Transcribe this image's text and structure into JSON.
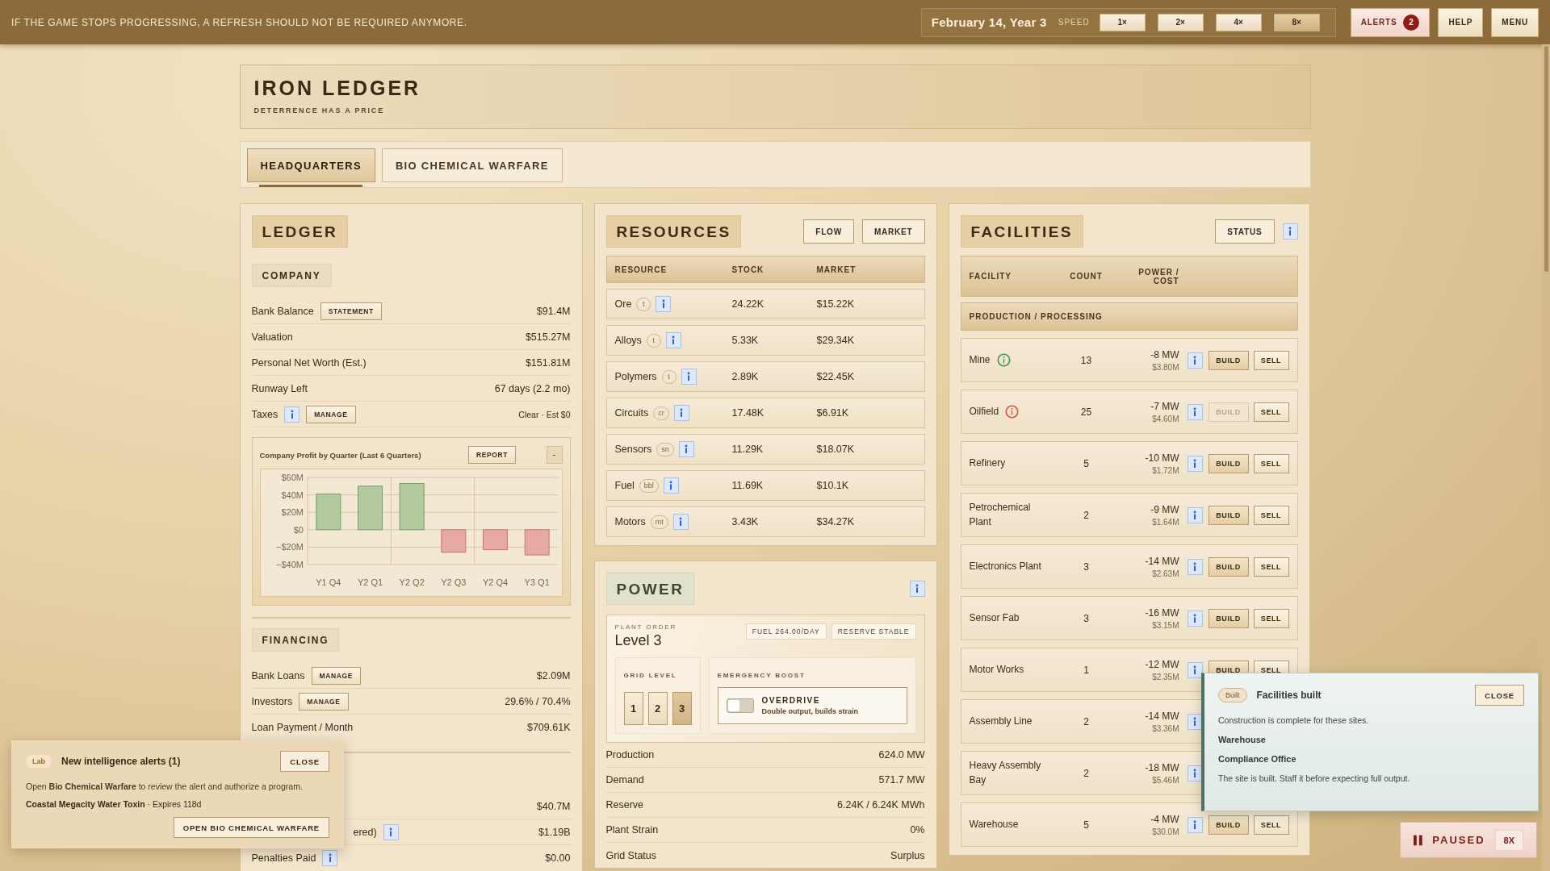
{
  "top_bar": {
    "notice": "IF THE GAME STOPS PROGRESSING, A REFRESH SHOULD NOT BE REQUIRED ANYMORE.",
    "date": "February 14, Year 3",
    "speed_label": "SPEED",
    "speeds": [
      {
        "label": "1×",
        "selected": false
      },
      {
        "label": "2×",
        "selected": false
      },
      {
        "label": "4×",
        "selected": false
      },
      {
        "label": "8×",
        "selected": true
      }
    ],
    "alerts": {
      "label": "ALERTS",
      "count": "2"
    },
    "buttons": [
      "HELP",
      "MENU"
    ]
  },
  "header": {
    "title": "IRON LEDGER",
    "subtitle": "DETERRENCE HAS A PRICE"
  },
  "tabs": [
    {
      "label": "HEADQUARTERS",
      "selected": true
    },
    {
      "label": "BIO CHEMICAL WARFARE",
      "selected": false
    }
  ],
  "ledger": {
    "title": "LEDGER",
    "sections": [
      {
        "title": "COMPANY",
        "rows": [
          {
            "kind": "plain",
            "label": "Bank Balance",
            "info": false,
            "button": "STATEMENT",
            "value": "$91.4M"
          },
          {
            "kind": "plain",
            "label": "Valuation",
            "info": false,
            "value": "$515.27M"
          },
          {
            "kind": "plain",
            "label": "Personal Net Worth (Est.)",
            "info": false,
            "value": "$151.81M"
          },
          {
            "kind": "plain",
            "label": "Runway Left",
            "info": false,
            "value": "67 days (2.2 mo)"
          },
          {
            "kind": "small",
            "label": "Taxes",
            "info": true,
            "button": "MANAGE",
            "value": "Clear · Est $0"
          }
        ],
        "chart": {
          "buttons": [
            "REPORT",
            "-"
          ],
          "chart_data": {
            "type": "bar",
            "grid": true,
            "title": "Company Profit by Quarter (Last 6 Quarters)",
            "categories": [
              "Y1 Q4",
              "Y2 Q1",
              "Y2 Q2",
              "Y2 Q3",
              "Y2 Q4",
              "Y3 Q1"
            ],
            "values": [
              41,
              50,
              53,
              -26,
              -23,
              -29
            ],
            "ylim": [
              -40,
              60
            ],
            "yticks": [
              {
                "value": 60,
                "label": "$60M"
              },
              {
                "value": 40,
                "label": "$40M"
              },
              {
                "value": 20,
                "label": "$20M"
              },
              {
                "value": 0,
                "label": "$0"
              },
              {
                "value": -20,
                "label": "−$20M"
              },
              {
                "value": -40,
                "label": "−$40M"
              }
            ]
          }
        }
      },
      {
        "title": "FINANCING",
        "rows": [
          {
            "kind": "plain",
            "label": "Bank Loans",
            "info": false,
            "button": "MANAGE",
            "value": "$2.09M"
          },
          {
            "kind": "plain",
            "label": "Investors",
            "info": false,
            "button": "MANAGE",
            "value": "29.6% / 70.4%"
          },
          {
            "kind": "plain",
            "label": "Loan Payment / Month",
            "info": false,
            "value": "$709.61K"
          }
        ]
      },
      {
        "rows": [
          {
            "kind": "covered",
            "info": false,
            "value": "$40.7M"
          },
          {
            "kind": "covered",
            "label": "ered)",
            "info": true,
            "value": "$1.19B"
          },
          {
            "kind": "plain",
            "label": "Penalties Paid",
            "info": true,
            "value": "$0.00"
          }
        ]
      }
    ]
  },
  "resources": {
    "title": "RESOURCES",
    "buttons": [
      "FLOW",
      "MARKET"
    ],
    "columns": [
      "RESOURCE",
      "STOCK",
      "MARKET"
    ],
    "rows": [
      {
        "name": "Ore",
        "unit": "t",
        "stock": "24.22K",
        "market": "$15.22K"
      },
      {
        "name": "Alloys",
        "unit": "t",
        "stock": "5.33K",
        "market": "$29.34K"
      },
      {
        "name": "Polymers",
        "unit": "t",
        "stock": "2.89K",
        "market": "$22.45K"
      },
      {
        "name": "Circuits",
        "unit": "cr",
        "stock": "17.48K",
        "market": "$6.91K"
      },
      {
        "name": "Sensors",
        "unit": "sn",
        "stock": "11.29K",
        "market": "$18.07K"
      },
      {
        "name": "Fuel",
        "unit": "bbl",
        "stock": "11.69K",
        "market": "$10.1K"
      },
      {
        "name": "Motors",
        "unit": "mt",
        "stock": "3.43K",
        "market": "$34.27K"
      }
    ]
  },
  "power": {
    "title": "POWER",
    "plant_order_label": "PLANT ORDER",
    "plant_order": "Level 3",
    "chips": [
      "FUEL 264.00/DAY",
      "RESERVE STABLE"
    ],
    "grid_level": {
      "label": "GRID LEVEL",
      "options": [
        {
          "label": "1",
          "selected": false
        },
        {
          "label": "2",
          "selected": false
        },
        {
          "label": "3",
          "selected": true
        }
      ]
    },
    "boost": {
      "label": "EMERGENCY BOOST",
      "name": "OVERDRIVE",
      "description": "Double output, builds strain",
      "on": false
    },
    "stats": [
      {
        "label": "Production",
        "value": "624.0 MW"
      },
      {
        "label": "Demand",
        "value": "571.7 MW"
      },
      {
        "label": "Reserve",
        "value": "6.24K / 6.24K MWh"
      },
      {
        "label": "Plant Strain",
        "value": "0%"
      },
      {
        "label": "Grid Status",
        "value": "Surplus"
      }
    ]
  },
  "facilities": {
    "title": "FACILITIES",
    "button": "STATUS",
    "columns": [
      "FACILITY",
      "COUNT",
      "POWER / COST"
    ],
    "group": "PRODUCTION / PROCESSING",
    "rows": [
      {
        "name": "Mine",
        "color": "#3f9a4f",
        "count": "13",
        "power": "-8 MW",
        "cost": "$3.80M",
        "actions": [
          {
            "label": "BUILD",
            "disabled": false
          },
          {
            "label": "SELL",
            "disabled": false
          }
        ]
      },
      {
        "name": "Oilfield",
        "color": "#d2554c",
        "count": "25",
        "power": "-7 MW",
        "cost": "$4.60M",
        "actions": [
          {
            "label": "BUILD",
            "disabled": true
          },
          {
            "label": "SELL",
            "disabled": false
          }
        ]
      },
      {
        "name": "Refinery",
        "count": "5",
        "power": "-10 MW",
        "cost": "$1.72M",
        "actions": [
          {
            "label": "BUILD",
            "disabled": false
          },
          {
            "label": "SELL",
            "disabled": false
          }
        ]
      },
      {
        "name": "Petrochemical Plant",
        "count": "2",
        "power": "-9 MW",
        "cost": "$1.64M",
        "actions": [
          {
            "label": "BUILD",
            "disabled": false
          },
          {
            "label": "SELL",
            "disabled": false
          }
        ]
      },
      {
        "name": "Electronics Plant",
        "count": "3",
        "power": "-14 MW",
        "cost": "$2.63M",
        "actions": [
          {
            "label": "BUILD",
            "disabled": false
          },
          {
            "label": "SELL",
            "disabled": false
          }
        ]
      },
      {
        "name": "Sensor Fab",
        "count": "3",
        "power": "-16 MW",
        "cost": "$3.15M",
        "actions": [
          {
            "label": "BUILD",
            "disabled": false
          },
          {
            "label": "SELL",
            "disabled": false
          }
        ]
      },
      {
        "name": "Motor Works",
        "count": "1",
        "power": "-12 MW",
        "cost": "$2.35M",
        "actions": [
          {
            "label": "BUILD",
            "disabled": false
          },
          {
            "label": "SELL",
            "disabled": false
          }
        ]
      },
      {
        "name": "Assembly Line",
        "count": "2",
        "power": "-14 MW",
        "cost": "$3.36M"
      },
      {
        "name": "Heavy Assembly Bay",
        "count": "2",
        "power": "-18 MW",
        "cost": "$5.46M"
      },
      {
        "name": "Warehouse",
        "count": "5",
        "power": "-4 MW",
        "cost": "$30.0M",
        "actions": [
          {
            "label": "BUILD",
            "disabled": false
          },
          {
            "label": "SELL",
            "disabled": false
          }
        ]
      }
    ]
  },
  "alert_toast": {
    "tag": "Lab",
    "title": "New intelligence alerts (1)",
    "close": "CLOSE",
    "message": "Open **Bio Chemical Warfare** to review the alert and authorize a program.",
    "item": "**Coastal Megacity Water Toxin** · Expires 118d",
    "action": "OPEN BIO CHEMICAL WARFARE"
  },
  "built_toast": {
    "tag": "Built",
    "title": "Facilities built",
    "close": "CLOSE",
    "message": "Construction is complete for these sites.",
    "sites": [
      "Warehouse",
      "Compliance Office"
    ],
    "note": "The site is built. Staff it before expecting full output."
  },
  "paused": {
    "label": "PAUSED",
    "speed": "8X"
  }
}
